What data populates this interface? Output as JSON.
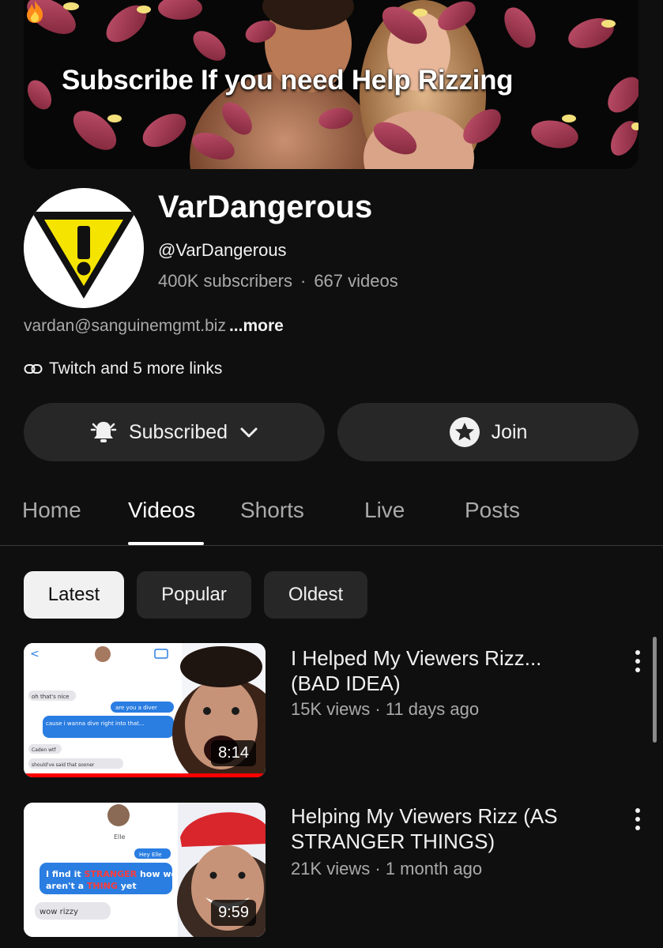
{
  "banner": {
    "text": "Subscribe If you need Help Rizzing",
    "icon": "fire-icon"
  },
  "channel": {
    "name": "VarDangerous",
    "handle": "@VarDangerous",
    "subscribers": "400K subscribers",
    "separator": "·",
    "videos": "667 videos",
    "description": "vardan@sanguinemgmt.biz",
    "more_label": "...more",
    "links_label": "Twitch and 5 more links",
    "avatar_icon": "warning-triangle-icon"
  },
  "actions": {
    "subscribed_label": "Subscribed",
    "join_label": "Join"
  },
  "tabs": [
    {
      "label": "Home",
      "active": false
    },
    {
      "label": "Videos",
      "active": true
    },
    {
      "label": "Shorts",
      "active": false
    },
    {
      "label": "Live",
      "active": false
    },
    {
      "label": "Posts",
      "active": false
    }
  ],
  "chips": [
    {
      "label": "Latest",
      "selected": true
    },
    {
      "label": "Popular",
      "selected": false
    },
    {
      "label": "Oldest",
      "selected": false
    }
  ],
  "videos": [
    {
      "title": "I Helped My Viewers Rizz... (BAD IDEA)",
      "meta": "15K views · 11 days ago",
      "duration": "8:14",
      "progress": 1.0,
      "thumb_text": {
        "msg1": "oh that's nice",
        "msg2": "are you a diver",
        "msg3": "cause i wanna dive right into that...",
        "msg4": "Caden wtf",
        "msg5": "should've said that sooner"
      }
    },
    {
      "title": "Helping My Viewers Rizz (AS STRANGER THINGS)",
      "meta": "21K views · 1 month ago",
      "duration": "9:59",
      "progress": 0,
      "thumb_text": {
        "name": "Elle",
        "msg1": "Hey Elle",
        "msg2a": "I find it",
        "msg2b": "STRANGER",
        "msg2c": "how we",
        "msg2d": "aren't a",
        "msg2e": "THING",
        "msg2f": "yet",
        "msg3": "wow rizzy"
      }
    }
  ],
  "colors": {
    "background": "#0f0f0f",
    "button_bg": "#272727",
    "accent_red": "#ff0000",
    "warning_yellow": "#f5e400"
  }
}
